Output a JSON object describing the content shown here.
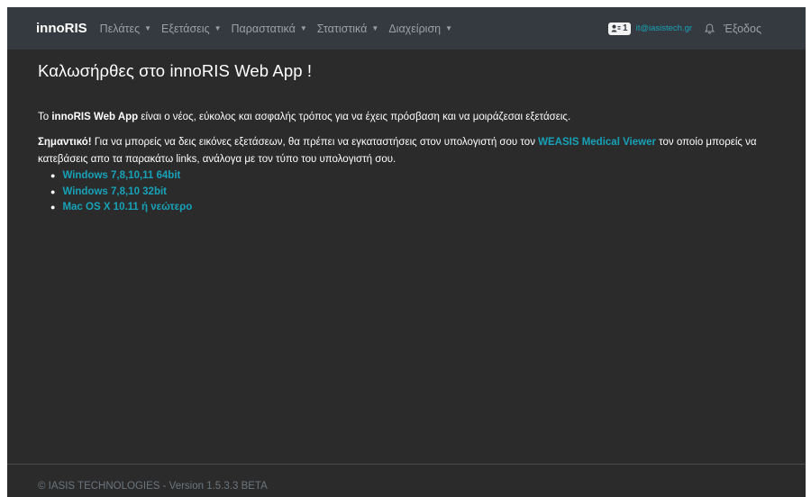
{
  "navbar": {
    "brand": "innoRIS",
    "menu": [
      {
        "label": "Πελάτες"
      },
      {
        "label": "Εξετάσεις"
      },
      {
        "label": "Παραστατικά"
      },
      {
        "label": "Στατιστικά"
      },
      {
        "label": "Διαχείριση"
      }
    ],
    "user_badge_count": "1",
    "user_email": "it@iasistech.gr",
    "logout_label": "Έξοδος"
  },
  "main": {
    "title": "Καλωσήρθες στο innoRIS Web App !",
    "intro": {
      "prefix": "Το ",
      "app_name": "innoRIS Web App",
      "suffix": " είναι ο νέος, εύκολος και ασφαλής τρόπος για να έχεις πρόσβαση και να μοιράζεσαι εξετάσεις."
    },
    "important": {
      "label": "Σημαντικό!",
      "text_before": " Για να μπορείς να δεις εικόνες εξετάσεων, θα πρέπει να εγκαταστήσεις στον υπολογιστή σου τον ",
      "viewer_link": "WEASIS Medical Viewer",
      "text_after": " τον οποίο μπορείς να κατεβάσεις απο τα παρακάτω links, ανάλογα με τον τύπο του υπολογιστή σου."
    },
    "downloads": [
      {
        "label": "Windows 7,8,10,11 64bit"
      },
      {
        "label": "Windows 7,8,10 32bit"
      },
      {
        "label": "Mac OS X 10.11 ή νεώτερο"
      }
    ]
  },
  "footer": {
    "text": "© IASIS TECHNOLOGIES - Version 1.5.3.3 BETA"
  },
  "colors": {
    "navbar_bg": "#343a40",
    "page_bg": "#2b2b2b",
    "link": "#17a2b8",
    "muted": "#9aa0a6"
  },
  "icons": [
    "caret-down-icon",
    "user-card-icon",
    "bell-icon",
    "bullet-icon"
  ]
}
